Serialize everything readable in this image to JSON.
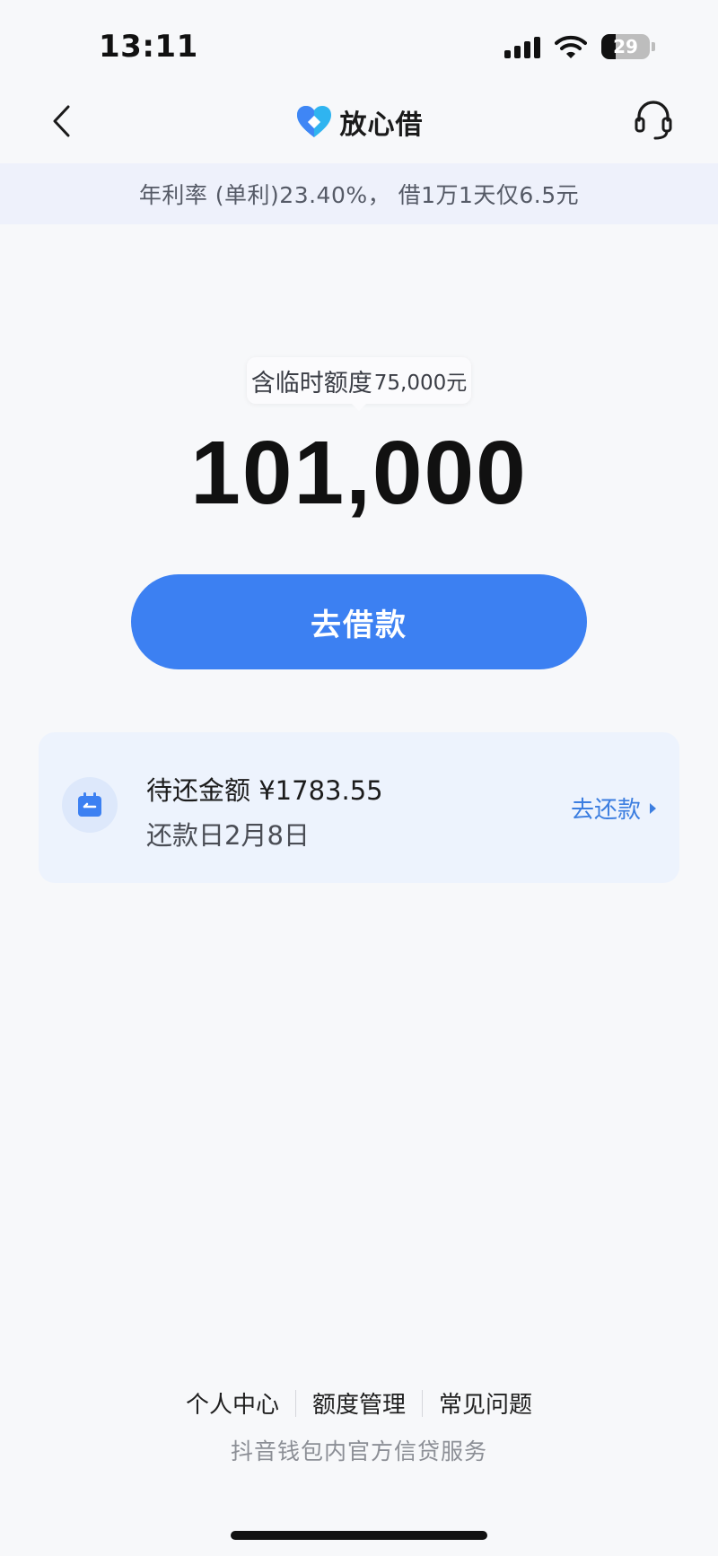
{
  "status_bar": {
    "time": "13:11",
    "battery_level": "29",
    "icons": [
      "signal-icon",
      "wifi-icon",
      "battery-icon"
    ]
  },
  "nav": {
    "title": "放心借",
    "back_icon": "chevron-left-icon",
    "support_icon": "headset-icon",
    "logo_icon": "heart-logo-icon"
  },
  "banner": {
    "rate_text": "年利率 (单利)23.40%， 借1万1天仅6.5元"
  },
  "credit": {
    "temp_quota_label": "含临时额度",
    "temp_quota_amount": "75,000元",
    "available_amount": "101,000",
    "borrow_button_label": "去借款"
  },
  "repayment": {
    "pending_label": "待还金额",
    "pending_amount": "¥1783.55",
    "due_date_text": "还款日2月8日",
    "action_label": "去还款",
    "icon": "calendar-icon"
  },
  "footer": {
    "links": [
      "个人中心",
      "额度管理",
      "常见问题"
    ],
    "note": "抖音钱包内官方信贷服务"
  },
  "colors": {
    "primary_blue": "#3c80f2",
    "link_blue": "#3c7ee0",
    "banner_bg": "#eef1fb",
    "card_bg": "#edf3fd",
    "page_bg": "#f7f8fa"
  }
}
